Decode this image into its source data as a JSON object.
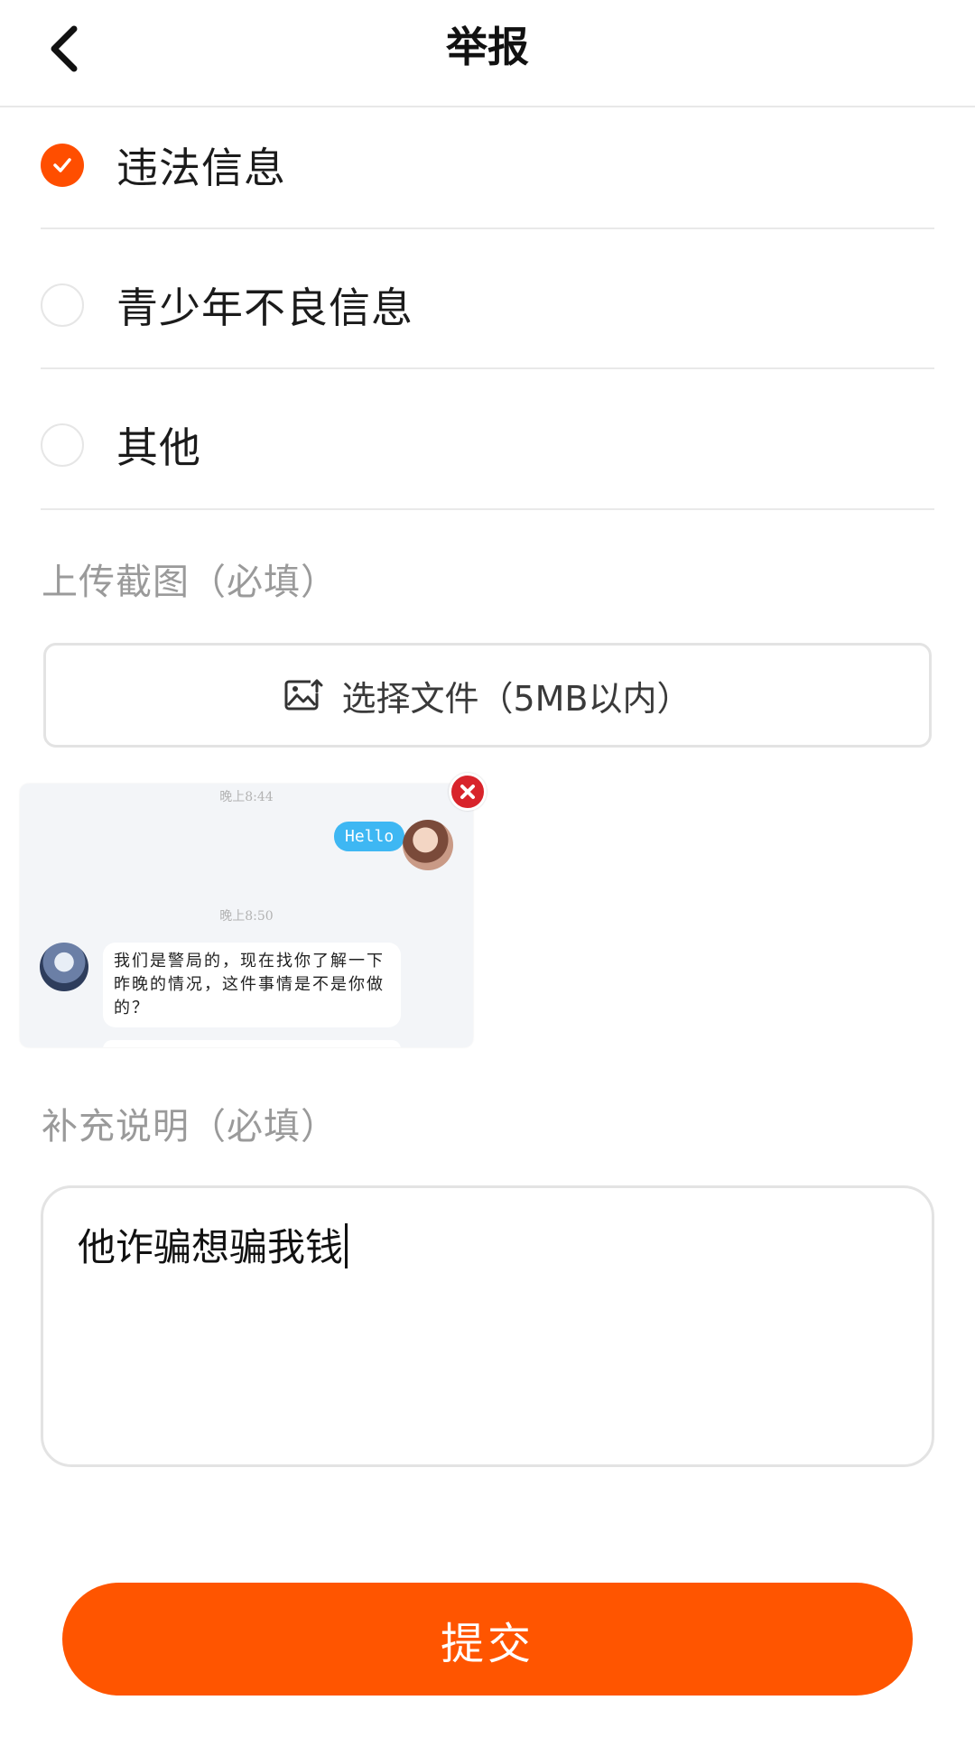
{
  "header": {
    "title": "举报",
    "back_icon": "chevron-left-icon"
  },
  "options": [
    {
      "label": "违法信息",
      "checked": true
    },
    {
      "label": "青少年不良信息",
      "checked": false
    },
    {
      "label": "其他",
      "checked": false
    }
  ],
  "upload": {
    "section_label": "上传截图（必填）",
    "button_label": "选择文件（5MB以内）",
    "icon": "image-upload-icon"
  },
  "preview": {
    "time_1": "晚上8:44",
    "bubble_1": "Hello",
    "time_2": "晚上8:50",
    "bubble_2": "我们是警局的，现在找你了解一下昨晚的情况，这件事情是不是你做的？",
    "remove_icon": "close-icon"
  },
  "description": {
    "section_label": "补充说明（必填）",
    "value": "他诈骗想骗我钱"
  },
  "submit": {
    "label": "提交"
  },
  "colors": {
    "accent": "#ff5500",
    "check": "#ff4e00",
    "remove": "#d8242b",
    "chat_bubble": "#3eb7f3"
  }
}
